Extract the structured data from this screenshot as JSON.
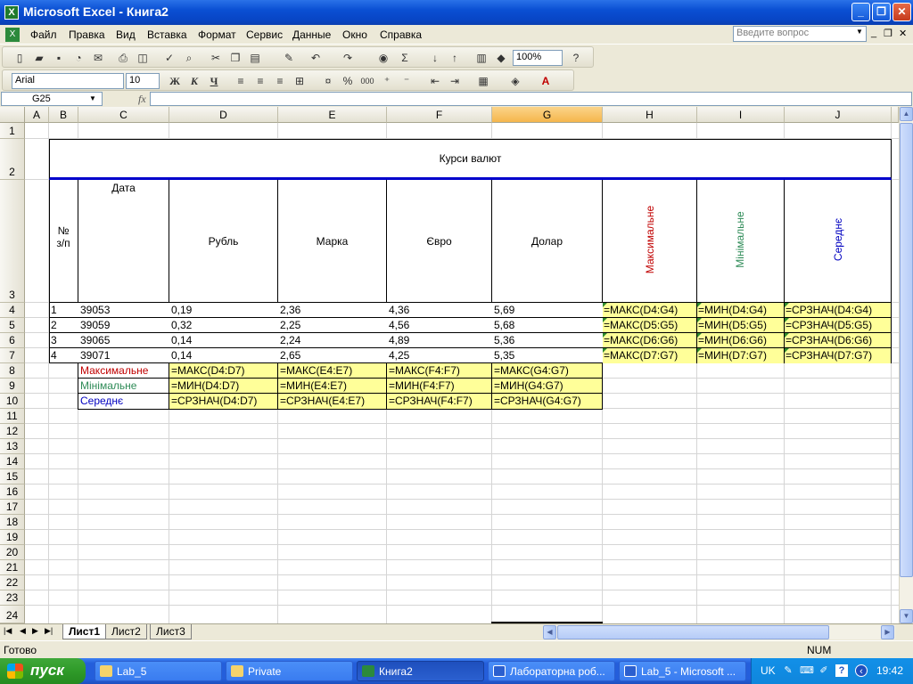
{
  "window": {
    "title": "Microsoft Excel - Книга2",
    "minimize": "_",
    "restore": "❐",
    "close": "✕"
  },
  "menu": {
    "items": [
      "Файл",
      "Правка",
      "Вид",
      "Вставка",
      "Формат",
      "Сервис",
      "Данные",
      "Окно",
      "Справка"
    ],
    "ask_placeholder": "Введите вопрос",
    "mdi_minimize": "_",
    "mdi_restore": "❐",
    "mdi_close": "✕"
  },
  "toolbar": {
    "zoom": "100%",
    "font": "Arial",
    "size": "10",
    "bold": "Ж",
    "italic": "К",
    "underline": "Ч",
    "sigma": "Σ",
    "percent": "%",
    "thousands": "000"
  },
  "formula_bar": {
    "name_box": "G25",
    "fx": "fx",
    "formula": ""
  },
  "sheet": {
    "columns": [
      "A",
      "B",
      "C",
      "D",
      "E",
      "F",
      "G",
      "H",
      "I",
      "J"
    ],
    "rows": [
      "1",
      "2",
      "3",
      "4",
      "5",
      "6",
      "7",
      "8",
      "9",
      "10",
      "11",
      "12",
      "13",
      "14",
      "15",
      "16",
      "17",
      "18",
      "19",
      "20",
      "21",
      "22",
      "23",
      "24"
    ],
    "title": "Курси валют",
    "header_no": "№",
    "header_zp": "з/п",
    "header_date": "Дата",
    "header_rub": "Рубль",
    "header_mark": "Марка",
    "header_euro": "Євро",
    "header_dollar": "Долар",
    "header_max": "Максимальне",
    "header_min": "Мінімальне",
    "header_avg": "Середнє",
    "data_rows": [
      {
        "n": "1",
        "date": "39053",
        "rub": "0,19",
        "mark": "2,36",
        "euro": "4,36",
        "dollar": "5,69",
        "max": "=МАКС(D4:G4)",
        "min": "=МИН(D4:G4)",
        "avg": "=СРЗНАЧ(D4:G4)"
      },
      {
        "n": "2",
        "date": "39059",
        "rub": "0,32",
        "mark": "2,25",
        "euro": "4,56",
        "dollar": "5,68",
        "max": "=МАКС(D5:G5)",
        "min": "=МИН(D5:G5)",
        "avg": "=СРЗНАЧ(D5:G5)"
      },
      {
        "n": "3",
        "date": "39065",
        "rub": "0,14",
        "mark": "2,24",
        "euro": "4,89",
        "dollar": "5,36",
        "max": "=МАКС(D6:G6)",
        "min": "=МИН(D6:G6)",
        "avg": "=СРЗНАЧ(D6:G6)"
      },
      {
        "n": "4",
        "date": "39071",
        "rub": "0,14",
        "mark": "2,65",
        "euro": "4,25",
        "dollar": "5,35",
        "max": "=МАКС(D7:G7)",
        "min": "=МИН(D7:G7)",
        "avg": "=СРЗНАЧ(D7:G7)"
      }
    ],
    "summary_rows": [
      {
        "label": "Максимальне",
        "d": "=МАКС(D4:D7)",
        "e": "=МАКС(E4:E7)",
        "f": "=МАКС(F4:F7)",
        "g": "=МАКС(G4:G7)"
      },
      {
        "label": "Мінімальне",
        "d": "=МИН(D4:D7)",
        "e": "=МИН(E4:E7)",
        "f": "=МИН(F4:F7)",
        "g": "=МИН(G4:G7)"
      },
      {
        "label": "Середнє",
        "d": "=СРЗНАЧ(D4:D7)",
        "e": "=СРЗНАЧ(E4:E7)",
        "f": "=СРЗНАЧ(F4:F7)",
        "g": "=СРЗНАЧ(G4:G7)"
      }
    ]
  },
  "tabs": [
    "Лист1",
    "Лист2",
    "Лист3"
  ],
  "status": {
    "text": "Готово",
    "num": "NUM"
  },
  "taskbar": {
    "start": "пуск",
    "tasks": [
      "Lab_5",
      "Private",
      "Книга2",
      "Лабораторна роб...",
      "Lab_5 - Microsoft ..."
    ],
    "lang": "UK",
    "clock": "19:42"
  },
  "colors": {
    "yellow_fill": "#ffff99",
    "max_red": "#c00000",
    "min_green": "#2e8b57",
    "avg_blue": "#0000c0",
    "title_underline": "#0000cc"
  }
}
